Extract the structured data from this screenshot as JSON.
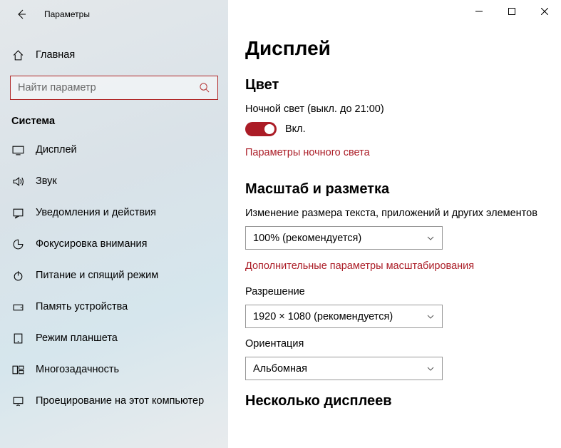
{
  "window": {
    "title": "Параметры"
  },
  "sidebar": {
    "home": "Главная",
    "searchPlaceholder": "Найти параметр",
    "category": "Система",
    "items": [
      {
        "label": "Дисплей"
      },
      {
        "label": "Звук"
      },
      {
        "label": "Уведомления и действия"
      },
      {
        "label": "Фокусировка внимания"
      },
      {
        "label": "Питание и спящий режим"
      },
      {
        "label": "Память устройства"
      },
      {
        "label": "Режим планшета"
      },
      {
        "label": "Многозадачность"
      },
      {
        "label": "Проецирование на этот компьютер"
      }
    ]
  },
  "main": {
    "heading": "Дисплей",
    "color": {
      "heading": "Цвет",
      "nightLightStatus": "Ночной свет (выкл. до 21:00)",
      "toggleLabel": "Вкл.",
      "settingsLink": "Параметры ночного света"
    },
    "scale": {
      "heading": "Масштаб и разметка",
      "scaleLabel": "Изменение размера текста, приложений и других элементов",
      "scaleValue": "100% (рекомендуется)",
      "advancedLink": "Дополнительные параметры масштабирования",
      "resolutionLabel": "Разрешение",
      "resolutionValue": "1920 × 1080 (рекомендуется)",
      "orientationLabel": "Ориентация",
      "orientationValue": "Альбомная"
    },
    "multi": {
      "heading": "Несколько дисплеев"
    }
  }
}
